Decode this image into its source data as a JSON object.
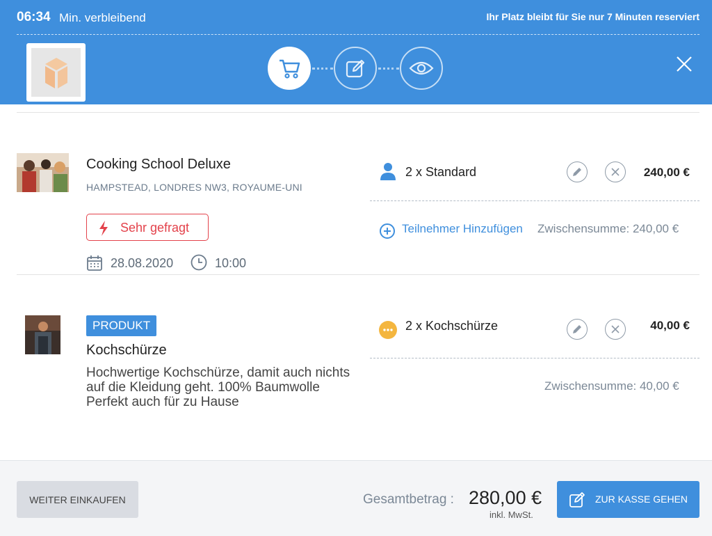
{
  "header": {
    "timer": "06:34",
    "timer_label": "Min. verbleibend",
    "reservation_note": "Ihr Platz bleibt für Sie nur 7 Minuten reserviert",
    "accent_color": "#3f8fdd",
    "steps": [
      {
        "icon": "cart-icon",
        "active": true
      },
      {
        "icon": "edit-icon",
        "active": false
      },
      {
        "icon": "eye-icon",
        "active": false
      }
    ]
  },
  "items": [
    {
      "title": "Cooking School Deluxe",
      "location": "HAMPSTEAD, LONDRES NW3, ROYAUME-UNI",
      "badge": "Sehr gefragt",
      "date": "28.08.2020",
      "time": "10:00",
      "line": {
        "label": "2 x Standard",
        "price": "240,00 €",
        "icon": "person-icon"
      },
      "add_participant": "Teilnehmer Hinzufügen",
      "subtotal": "Zwischensumme:  240,00 €"
    },
    {
      "tag": "PRODUKT",
      "title": "Kochschürze",
      "description": "Hochwertige Kochschürze, damit auch nichts auf die Kleidung geht. 100% Baumwolle Perfekt auch für zu Hause",
      "line": {
        "label": "2 x Kochschürze",
        "price": "40,00 €",
        "icon": "more-dots-icon"
      },
      "subtotal": "Zwischensumme:  40,00 €"
    }
  ],
  "footer": {
    "continue_label": "WEITER EINKAUFEN",
    "total_label": "Gesamtbetrag :",
    "total_amount": "280,00 €",
    "tax_note": "inkl. MwSt.",
    "checkout_label": "ZUR KASSE GEHEN"
  }
}
